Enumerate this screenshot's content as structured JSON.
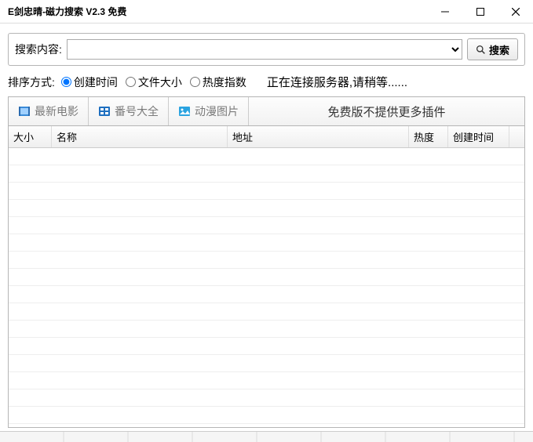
{
  "window": {
    "title": "E剑忠晴-磁力搜索 V2.3 免费"
  },
  "search": {
    "label": "搜索内容:",
    "value": "",
    "button": "搜索"
  },
  "sort": {
    "label": "排序方式:",
    "options": [
      "创建时间",
      "文件大小",
      "热度指数"
    ],
    "selected": 0
  },
  "status": "正在连接服务器,请稍等......",
  "toolbar": {
    "items": [
      {
        "label": "最新电影",
        "icon": "film"
      },
      {
        "label": "番号大全",
        "icon": "catalog"
      },
      {
        "label": "动漫图片",
        "icon": "image"
      }
    ],
    "banner": "免费版不提供更多插件"
  },
  "table": {
    "columns": [
      "大小",
      "名称",
      "地址",
      "热度",
      "创建时间"
    ],
    "rows": []
  }
}
